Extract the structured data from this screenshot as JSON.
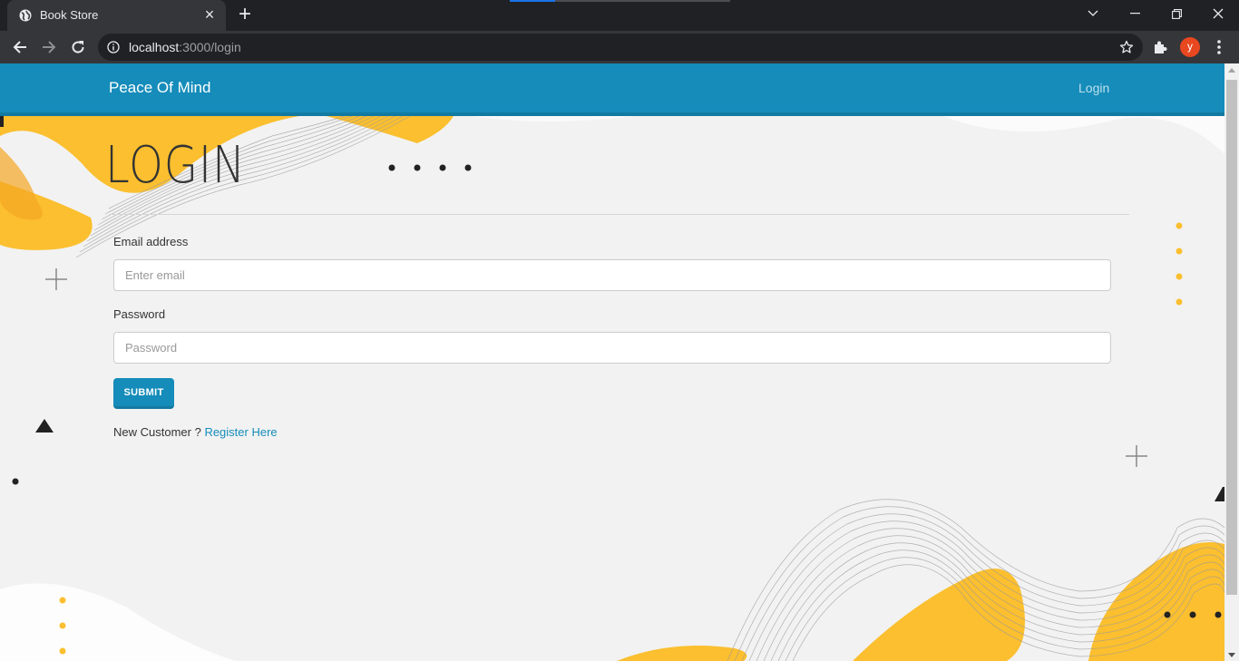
{
  "browser": {
    "tab_title": "Book Store",
    "url_host": "localhost",
    "url_path": ":3000/login",
    "avatar_letter": "y",
    "icons": [
      "globe-icon",
      "close-icon",
      "plus-icon",
      "chevron-down-icon",
      "minimize-icon",
      "restore-icon",
      "close-window-icon",
      "back-arrow-icon",
      "forward-arrow-icon",
      "reload-icon",
      "info-icon",
      "star-icon",
      "puzzle-icon",
      "kebab-icon"
    ]
  },
  "navbar": {
    "brand": "Peace Of Mind",
    "login_link": "Login",
    "color": "#158cba"
  },
  "form": {
    "heading": "LOGIN",
    "email_label": "Email address",
    "email_placeholder": "Enter email",
    "password_label": "Password",
    "password_placeholder": "Password",
    "submit_label": "SUBMIT",
    "new_customer_text": "New Customer ?",
    "register_link": "Register Here"
  },
  "colors": {
    "accent": "#158cba",
    "background": "#f2f2f2",
    "decor_yellow": "#fbbf2f"
  }
}
